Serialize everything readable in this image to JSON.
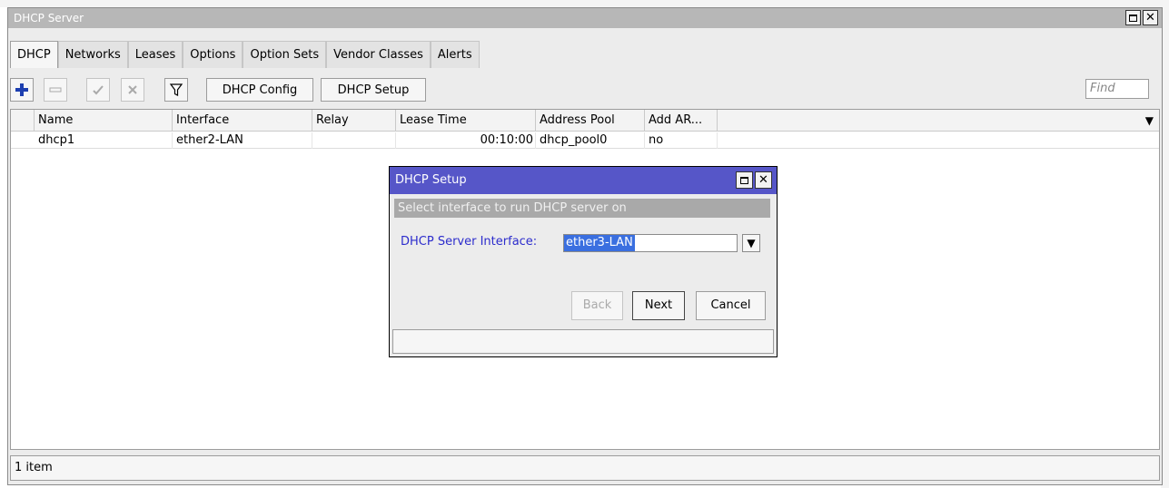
{
  "window": {
    "title": "DHCP Server",
    "tabs": [
      "DHCP",
      "Networks",
      "Leases",
      "Options",
      "Option Sets",
      "Vendor Classes",
      "Alerts"
    ],
    "active_tab": "DHCP"
  },
  "toolbar": {
    "dhcp_config_label": "DHCP Config",
    "dhcp_setup_label": "DHCP Setup",
    "find_placeholder": "Find"
  },
  "table": {
    "columns": [
      "Name",
      "Interface",
      "Relay",
      "Lease Time",
      "Address Pool",
      "Add AR..."
    ],
    "rows": [
      {
        "name": "dhcp1",
        "interface": "ether2-LAN",
        "relay": "",
        "lease_time": "00:10:00",
        "address_pool": "dhcp_pool0",
        "add_arp": "no"
      }
    ]
  },
  "status": {
    "text": "1 item"
  },
  "dialog": {
    "title": "DHCP Setup",
    "caption": "Select interface to run DHCP server on",
    "field_label": "DHCP Server Interface:",
    "field_value": "ether3-LAN",
    "back_label": "Back",
    "next_label": "Next",
    "cancel_label": "Cancel"
  },
  "colors": {
    "dialog_title_bg": "#5656c8",
    "selection": "#3a6fe0",
    "label_blue": "#2c2ccc"
  }
}
